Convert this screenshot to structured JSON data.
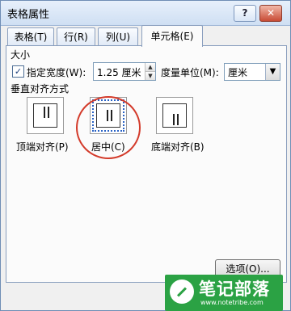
{
  "window": {
    "title": "表格属性",
    "help": "?",
    "close": "✕"
  },
  "tabs": [
    "表格(T)",
    "行(R)",
    "列(U)",
    "单元格(E)"
  ],
  "size_group": {
    "label": "大小"
  },
  "width": {
    "checkbox": "✓",
    "label": "指定宽度(W):",
    "value": "1.25 厘米",
    "spin_up": "▲",
    "spin_down": "▼"
  },
  "unit": {
    "label": "度量单位(M):",
    "value": "厘米",
    "arrow": "▼"
  },
  "valign_group": {
    "label": "垂直对齐方式"
  },
  "valign_options": [
    {
      "label": "顶端对齐(P)",
      "selected": false
    },
    {
      "label": "居中(C)",
      "selected": true
    },
    {
      "label": "底端对齐(B)",
      "selected": false
    }
  ],
  "buttons": {
    "options": "选项(O)..."
  },
  "watermark": {
    "text": "笔记部落",
    "url": "www.notetribe.com"
  }
}
